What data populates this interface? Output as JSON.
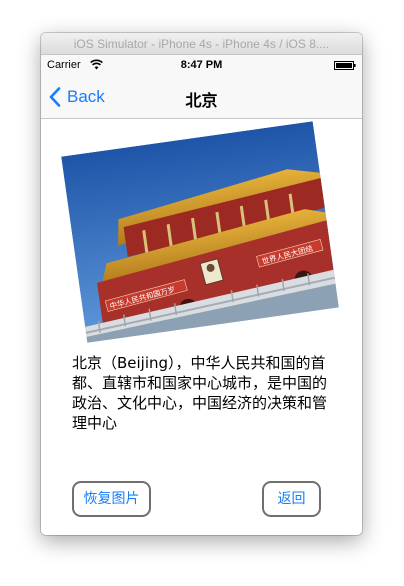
{
  "window": {
    "title": "iOS Simulator - iPhone 4s - iPhone 4s / iOS 8...."
  },
  "status_bar": {
    "carrier": "Carrier",
    "time": "8:47 PM",
    "wifi_icon": "wifi-icon",
    "battery_icon": "battery-icon"
  },
  "nav_bar": {
    "back_label": "Back",
    "title": "北京"
  },
  "photo": {
    "sign_left": "中华人民共和国万岁",
    "sign_right": "世界人民大团结"
  },
  "main": {
    "description": "北京（Beijing），中华人民共和国的首都、直辖市和国家中心城市，是中国的政治、文化中心，中国经济的决策和管理中心"
  },
  "buttons": {
    "restore_label": "恢复图片",
    "return_label": "返回"
  },
  "colors": {
    "accent": "#157efb",
    "button_border": "#6f6f6f"
  }
}
